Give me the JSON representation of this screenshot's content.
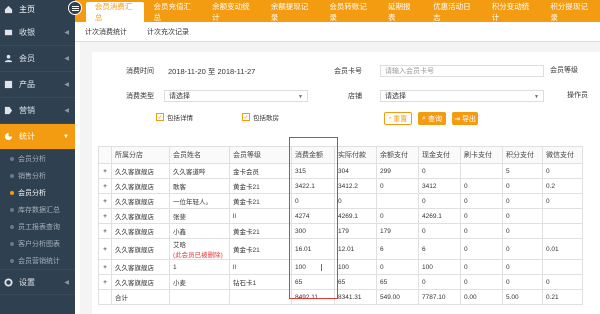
{
  "sidebar": {
    "home": "主页",
    "items": [
      {
        "label": "收银",
        "icon": "register-icon"
      },
      {
        "label": "会员",
        "icon": "user-icon"
      },
      {
        "label": "产品",
        "icon": "product-icon"
      },
      {
        "label": "营销",
        "icon": "tag-icon"
      },
      {
        "label": "统计",
        "icon": "stats-icon"
      }
    ],
    "subitems": [
      "会员分析",
      "销售分析",
      "会员分析",
      "库存数据汇总",
      "员工报表查询",
      "客户分析图表",
      "会员营销统计"
    ],
    "settings": "设置"
  },
  "tabs": [
    "会员消费汇总",
    "会员充值汇总",
    "余额变动统计",
    "余额提现记录",
    "会员转账记录",
    "延期报表",
    "优惠活动日志",
    "积分变动统计",
    "积分提现记录"
  ],
  "subtabs": [
    "计次消费统计",
    "计次充次记录"
  ],
  "filters": {
    "date_label": "消费时间",
    "date_value": "2018-11-20 至 2018-11-27",
    "card_label": "会员卡号",
    "card_placeholder": "请输入会员卡号",
    "level_label": "会员等级",
    "type_label": "消费类型",
    "type_value": "请选择",
    "store_label": "店铺",
    "store_value": "请选择",
    "operator_label": "操作员",
    "chk1": "包括详情",
    "chk2": "包括歌房"
  },
  "buttons": {
    "reset": "重置",
    "query": "查询",
    "export": "导出"
  },
  "table": {
    "headers": [
      "",
      "所属分店",
      "会员姓名",
      "会员等级",
      "消费金额",
      "实际付款",
      "余额支付",
      "现金支付",
      "刷卡支付",
      "积分支付",
      "微信支付"
    ],
    "rows": [
      [
        "+",
        "久久客旗舰店",
        "久久客道哔",
        "金卡会员",
        "315",
        "304",
        "299",
        "0",
        "",
        "5",
        "0"
      ],
      [
        "+",
        "久久客旗舰店",
        "歌客",
        "黄金卡21",
        "3422.1",
        "3412.2",
        "0",
        "3412",
        "0",
        "0",
        "0.2"
      ],
      [
        "+",
        "久久客旗舰店",
        "一位年轻人。",
        "黄金卡21",
        "0",
        "0",
        "",
        "0",
        "0",
        "0",
        "0"
      ],
      [
        "+",
        "久久客旗舰店",
        "张斐",
        "ll",
        "4274",
        "4269.1",
        "0",
        "4269.1",
        "0",
        "0",
        ""
      ],
      [
        "+",
        "久久客旗舰店",
        "小鑫",
        "黄金卡21",
        "300",
        "179",
        "179",
        "0",
        "0",
        "0",
        ""
      ],
      [
        "+",
        "久久客旗舰店",
        "艾晗",
        "黄金卡21",
        "16.01",
        "12.01",
        "6",
        "6",
        "0",
        "0",
        "0.01"
      ],
      [
        "+",
        "久久客旗舰店",
        "1",
        "ll",
        "100",
        "100",
        "0",
        "100",
        "0",
        "0",
        ""
      ],
      [
        "+",
        "久久客旗舰店",
        "小麦",
        "钻石卡1",
        "65",
        "65",
        "65",
        "0",
        "0",
        "0",
        "0"
      ],
      [
        "",
        "合计",
        "",
        "",
        "8492.11",
        "8341.31",
        "549.00",
        "7787.10",
        "0.00",
        "5.00",
        "0.21"
      ]
    ],
    "deleted_note": "(此会员已被删除)"
  }
}
